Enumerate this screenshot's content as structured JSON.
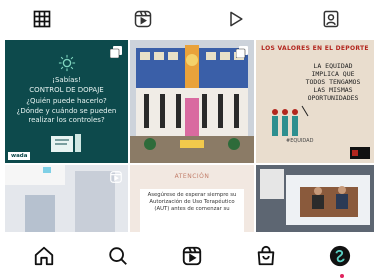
{
  "tabs": [
    {
      "icon": "grid-icon",
      "active": true
    },
    {
      "icon": "reels-tab-icon",
      "active": false
    },
    {
      "icon": "play-icon",
      "active": false
    },
    {
      "icon": "tagged-person-icon",
      "active": false
    }
  ],
  "posts": [
    {
      "type": "carousel",
      "lines": [
        "¡Sabías!",
        "CONTROL DE DOPAJE",
        "¿Quién puede hacerlo?",
        "¿Dónde y cuándo se pueden",
        "realizar los controles?"
      ],
      "badge": "wada"
    },
    {
      "type": "carousel"
    },
    {
      "type": "carousel",
      "title": "LOS VALORES EN EL DEPORTE",
      "body": [
        "LA EQUIDAD",
        "IMPLICA QUE",
        "TODOS TENGAMOS",
        "LAS MISMAS",
        "OPORTUNIDADES"
      ],
      "tag": "#EQUIDAD"
    },
    {
      "type": "reel"
    },
    {
      "type": "post",
      "title": "ATENCIÓN",
      "body": [
        "Asegúrese de esperar siempre su",
        "Autorización de Uso Terapéutico",
        "(AUT) antes de comenzar su"
      ]
    },
    {
      "type": "post"
    }
  ],
  "nav": [
    {
      "icon": "home-icon"
    },
    {
      "icon": "search-icon"
    },
    {
      "icon": "reels-icon"
    },
    {
      "icon": "shop-icon"
    },
    {
      "icon": "profile-avatar-icon"
    }
  ],
  "colors": {
    "accent": "#e0245e",
    "teal": "#0d4a4c"
  }
}
